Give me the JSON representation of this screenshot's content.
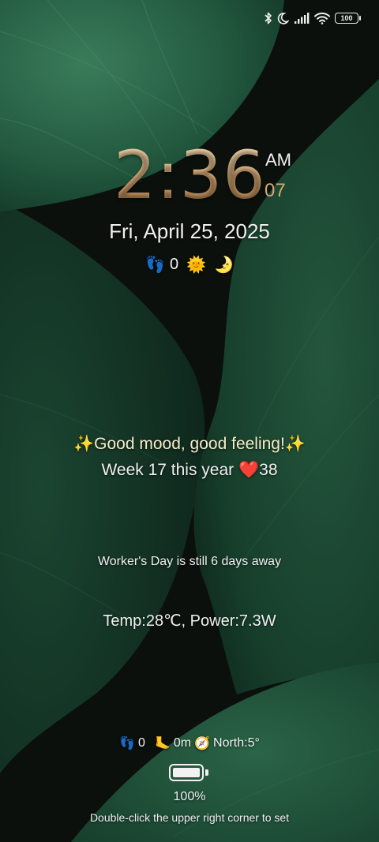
{
  "status_bar": {
    "icons": [
      "bluetooth-icon",
      "do-not-disturb-moon-icon",
      "cellular-signal-icon",
      "wifi-icon"
    ],
    "battery_level": "100"
  },
  "clock": {
    "time": "2:36",
    "ampm": "AM",
    "seconds": "07"
  },
  "date": "Fri, April 25, 2025",
  "mini_status": {
    "footprints_icon": "👣",
    "steps": "0",
    "sun_icon": "🌞",
    "moon_icon": "🌛"
  },
  "mood_text": "✨Good mood, good feeling!✨",
  "week": {
    "text": "Week 17 this year ",
    "heart_icon": "❤️",
    "count": "38"
  },
  "holiday_text": "Worker's Day is still 6 days away",
  "temp_power": "Temp:28℃, Power:7.3W",
  "sensors": {
    "footprints_icon": "👣",
    "steps": "0",
    "foot_icon": "🦶",
    "distance": "0m",
    "compass_icon": "🧭",
    "heading": "North:5°"
  },
  "battery": {
    "level_fraction": 1.0,
    "percent": "100%"
  },
  "hint": "Double-click the upper right corner to set",
  "colors": {
    "background": "#0b100d",
    "leaf_dark": "#16412c",
    "leaf_light": "#2c6b4c",
    "clock_gold": "#d7a872",
    "text": "#f0f0f0"
  }
}
